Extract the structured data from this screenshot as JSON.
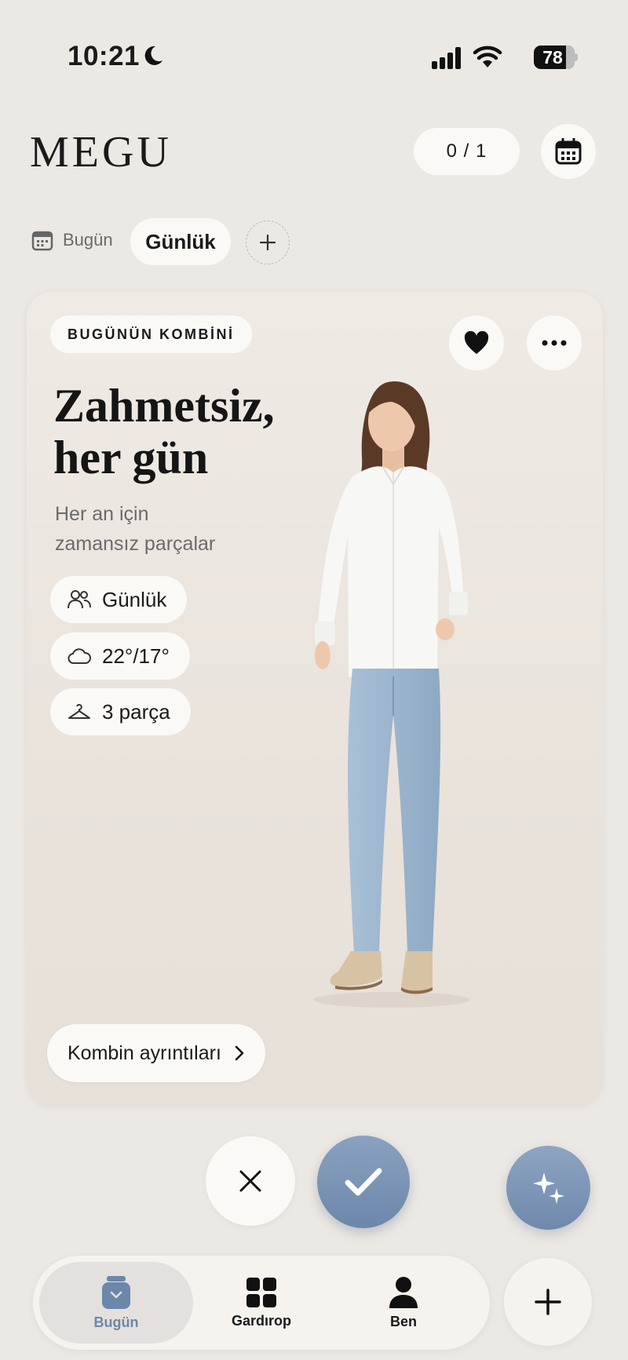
{
  "status_bar": {
    "time": "10:21",
    "battery": "78",
    "battery_level_percent": 78,
    "icons": [
      "moon-icon",
      "signal-icon",
      "wifi-icon",
      "battery-icon"
    ]
  },
  "header": {
    "brand": "MEGU",
    "counter": "0 / 1",
    "calendar_icon": "calendar-icon"
  },
  "filters": {
    "date_label": "Bugün",
    "active_chip": "Günlük",
    "add_icon": "plus-icon"
  },
  "card": {
    "badge": "BUGÜNÜN KOMBİNİ",
    "title_lines": [
      "Zahmetsiz,",
      "her gün"
    ],
    "subtitle_lines": [
      "Her an için",
      "zamansız parçalar"
    ],
    "chips": [
      {
        "icon": "people-icon",
        "label": "Günlük"
      },
      {
        "icon": "cloud-icon",
        "label": "22°/17°"
      },
      {
        "icon": "hanger-icon",
        "label": "3 parça"
      }
    ],
    "details_button": "Kombin ayrıntıları",
    "actions": [
      "heart-icon",
      "more-icon"
    ]
  },
  "actions": {
    "dismiss_icon": "close-icon",
    "accept_icon": "check-icon",
    "ai_icon": "sparkle-icon"
  },
  "nav": {
    "items": [
      {
        "label": "Bugün",
        "icon": "today-icon",
        "active": true
      },
      {
        "label": "Gardırop",
        "icon": "grid-icon",
        "active": false
      },
      {
        "label": "Ben",
        "icon": "person-icon",
        "active": false
      }
    ],
    "add_icon": "plus-icon"
  },
  "colors": {
    "background": "#ece8e3",
    "surface": "#fbf9f6",
    "accent": "#6c87aa",
    "text": "#1a1a1a"
  }
}
